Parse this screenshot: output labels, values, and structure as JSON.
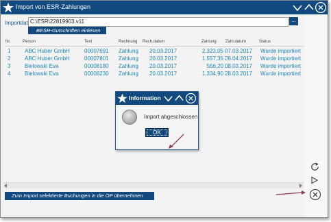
{
  "window": {
    "title": "Import von ESR-Zahlungen"
  },
  "import": {
    "label": "Importdat",
    "path": "C:\\ESR\\22819903.v11",
    "browse_label": "...",
    "besr_button": "BESR-Gutschriften einlesen"
  },
  "table": {
    "headers": [
      "Nr.",
      "Person",
      "Text",
      "Rechnung",
      "Rech.datum",
      "Zahlung",
      "Zahl.datum",
      "Status"
    ],
    "rows": [
      [
        "1",
        "ABC Huber GmbH",
        "00007691",
        "Zahlung",
        "20.03.2017",
        "2.323,05",
        "07.03.2017",
        "Wurde importiert"
      ],
      [
        "2",
        "ABC Huber GmbH",
        "00007801",
        "Zahlung",
        "20.03.2017",
        "1.557,35",
        "26.04.2017",
        "Wurde importiert"
      ],
      [
        "3",
        "Bielowski Eva",
        "00008180",
        "Zahlung",
        "20.03.2017",
        "556,20",
        "08.03.2017",
        "Wurde importiert"
      ],
      [
        "4",
        "Bielowski Eva",
        "00008230",
        "Zahlung",
        "20.03.2017",
        "1.334,90",
        "28.03.2017",
        "Wurde importiert"
      ]
    ]
  },
  "footer": {
    "take_button": "Zum Import selektierte Buchungen in die OP übernehmen"
  },
  "dialog": {
    "title": "Information",
    "message": "Import abgeschlossen",
    "ok_label": "OK"
  },
  "colors": {
    "brand": "#124a80",
    "link_text": "#1a86b8",
    "annotation_arrow": "#8b3a50"
  },
  "icons": [
    "star-icon",
    "chevron-down-icon",
    "chevron-up-icon",
    "close-icon",
    "refresh-icon",
    "play-icon",
    "info-icon"
  ]
}
